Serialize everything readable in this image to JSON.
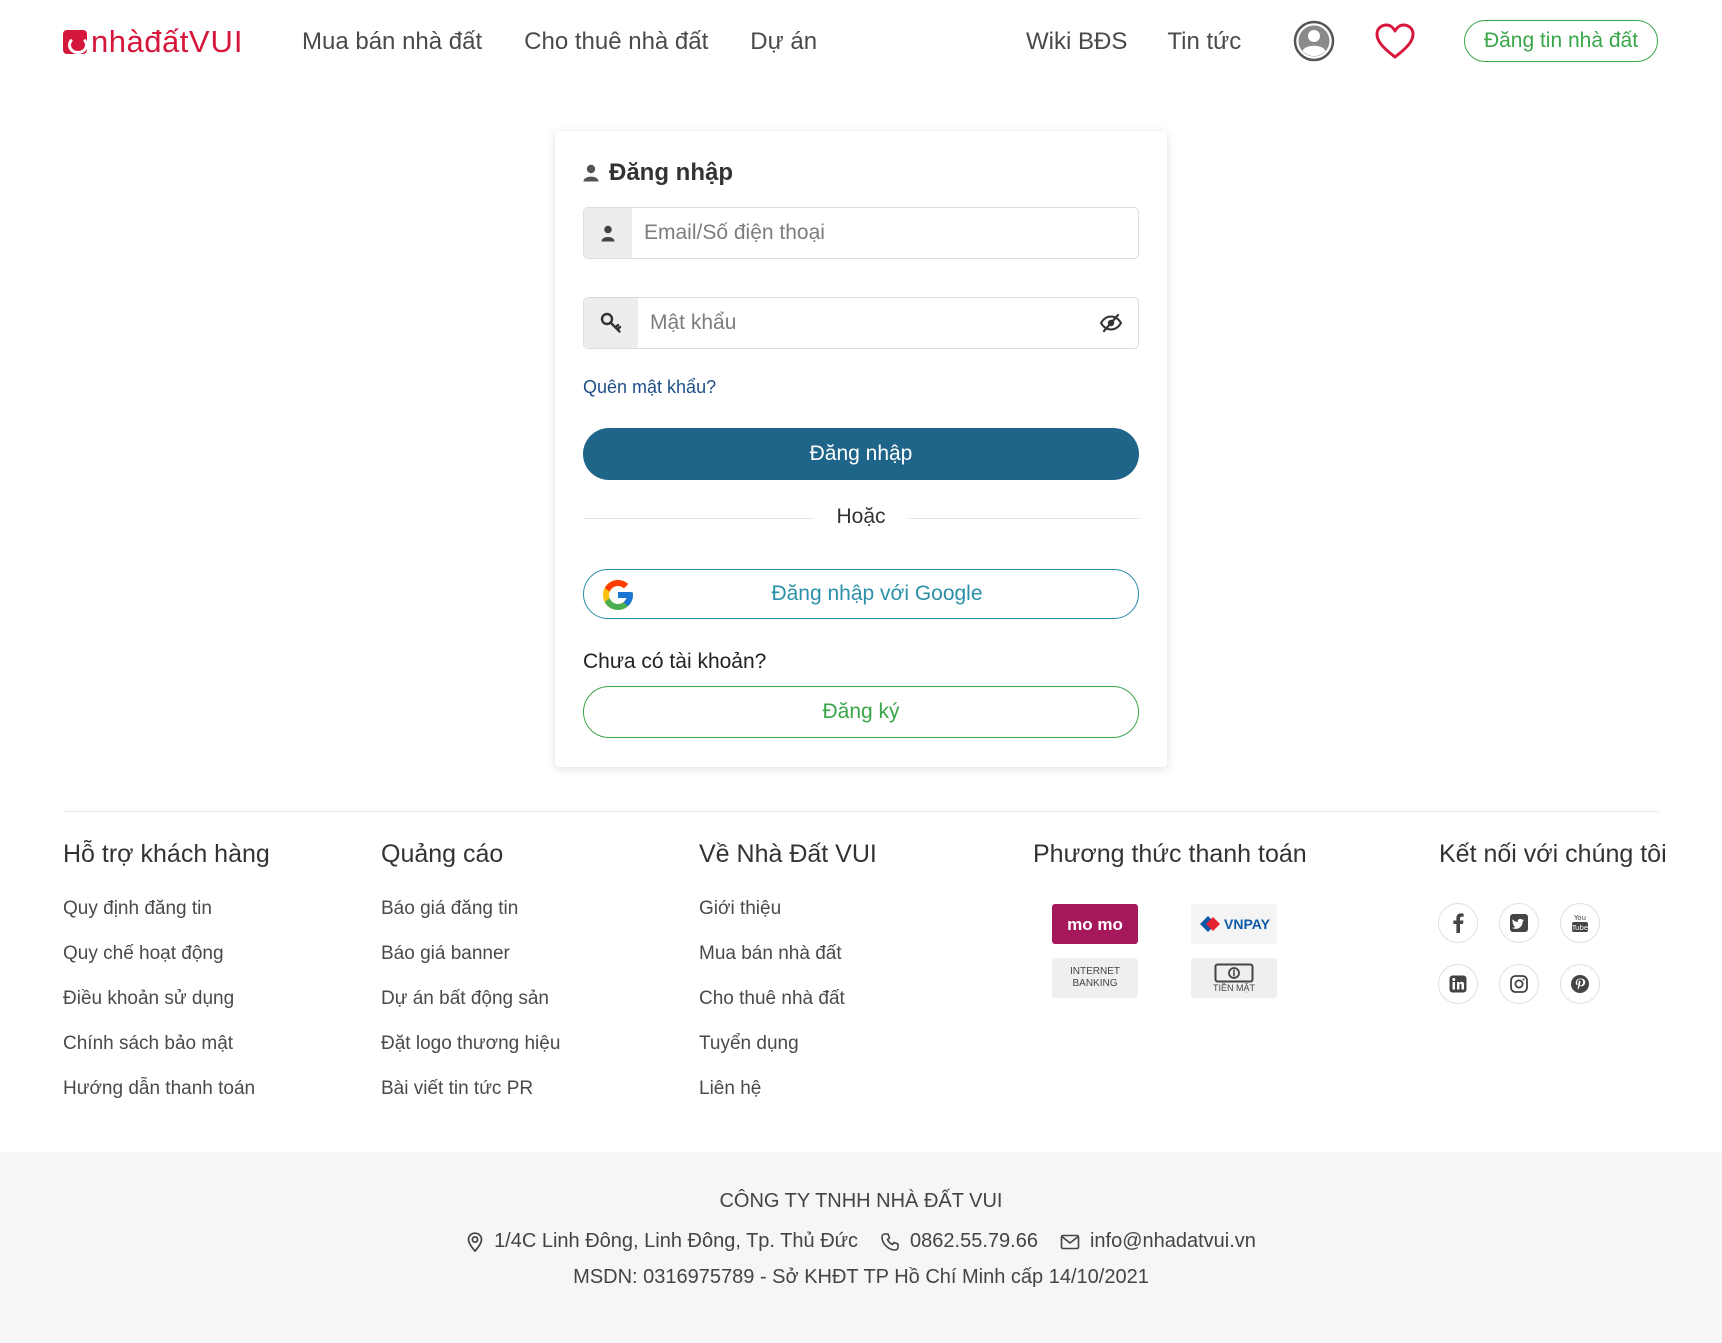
{
  "header": {
    "logo_prefix": "nhà",
    "logo_mid": "đất",
    "logo_suffix": "VUI",
    "nav_left": [
      "Mua bán nhà đất",
      "Cho thuê nhà đất",
      "Dự án"
    ],
    "nav_right": [
      "Wiki BĐS",
      "Tin tức"
    ],
    "post_button": "Đăng tin nhà đất",
    "user_icon": "user-circle-icon",
    "heart_icon": "heart-icon"
  },
  "login": {
    "title": "Đăng nhập",
    "email_placeholder": "Email/Số điện thoại",
    "email_value": "",
    "password_placeholder": "Mật khẩu",
    "password_value": "",
    "forgot_link": "Quên mật khẩu?",
    "submit": "Đăng nhập",
    "or_text": "Hoặc",
    "google_button": "Đăng nhập với Google",
    "no_account_text": "Chưa có tài khoản?",
    "register_button": "Đăng ký"
  },
  "footer": {
    "support": {
      "title": "Hỗ trợ khách hàng",
      "links": [
        "Quy định đăng tin",
        "Quy chế hoạt động",
        "Điều khoản sử dụng",
        "Chính sách bảo mật",
        "Hướng dẫn thanh toán"
      ]
    },
    "ads": {
      "title": "Quảng cáo",
      "links": [
        "Báo giá đăng tin",
        "Báo giá banner",
        "Dự án bất động sản",
        "Đặt logo thương hiệu",
        "Bài viết tin tức PR"
      ]
    },
    "about": {
      "title": "Về Nhà Đất VUI",
      "links": [
        "Giới thiệu",
        "Mua bán nhà đất",
        "Cho thuê nhà đất",
        "Tuyển dụng",
        "Liên hệ"
      ]
    },
    "payment": {
      "title": "Phương thức thanh toán",
      "momo": "mo mo",
      "vnpay": "VNPAY",
      "bank_line1": "INTERNET",
      "bank_line2": "BANKING",
      "cash": "TIỀN MẶT"
    },
    "social": {
      "title": "Kết nối với chúng tôi",
      "icons": [
        "facebook-icon",
        "twitter-icon",
        "youtube-icon",
        "linkedin-icon",
        "instagram-icon",
        "pinterest-icon"
      ]
    },
    "company_name": "CÔNG TY TNHH NHÀ ĐẤT VUI",
    "address": "1/4C Linh Đông, Linh Đông, Tp. Thủ Đức",
    "phone": "0862.55.79.66",
    "email": "info@nhadatvui.vn",
    "msdn": "MSDN: 0316975789 - Sở KHĐT TP Hồ Chí Minh cấp 14/10/2021"
  },
  "colors": {
    "brand_red": "#d6173c",
    "primary_blue": "#1f6489",
    "green": "#3aa64a",
    "google_teal": "#2a8fa8"
  }
}
